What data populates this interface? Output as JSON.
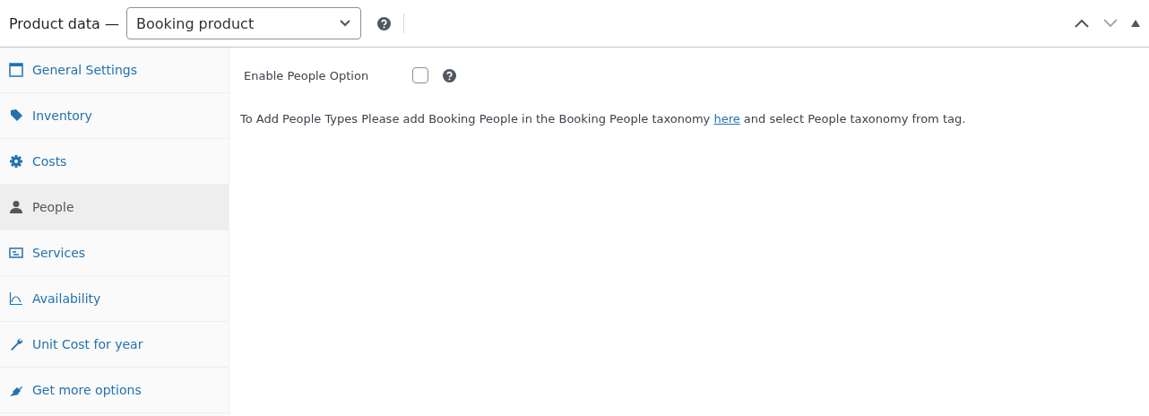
{
  "header": {
    "title": "Product data —",
    "product_type": {
      "value": "Booking product"
    }
  },
  "tabs": [
    {
      "label": "General Settings",
      "kind": "window",
      "selected": false
    },
    {
      "label": "Inventory",
      "kind": "tag",
      "selected": false
    },
    {
      "label": "Costs",
      "kind": "gear",
      "selected": false
    },
    {
      "label": "People",
      "kind": "person",
      "selected": true
    },
    {
      "label": "Services",
      "kind": "card",
      "selected": false
    },
    {
      "label": "Availability",
      "kind": "chart",
      "selected": false
    },
    {
      "label": "Unit Cost for year",
      "kind": "wrench",
      "selected": false
    },
    {
      "label": "Get more options",
      "kind": "plug",
      "selected": false
    }
  ],
  "panel": {
    "enable_people": {
      "label": "Enable People Option",
      "checked": false
    },
    "note": {
      "before": "To Add People Types Please add Booking People in the Booking People taxonomy",
      "link": "here",
      "after": "and select People taxonomy from tag."
    }
  }
}
